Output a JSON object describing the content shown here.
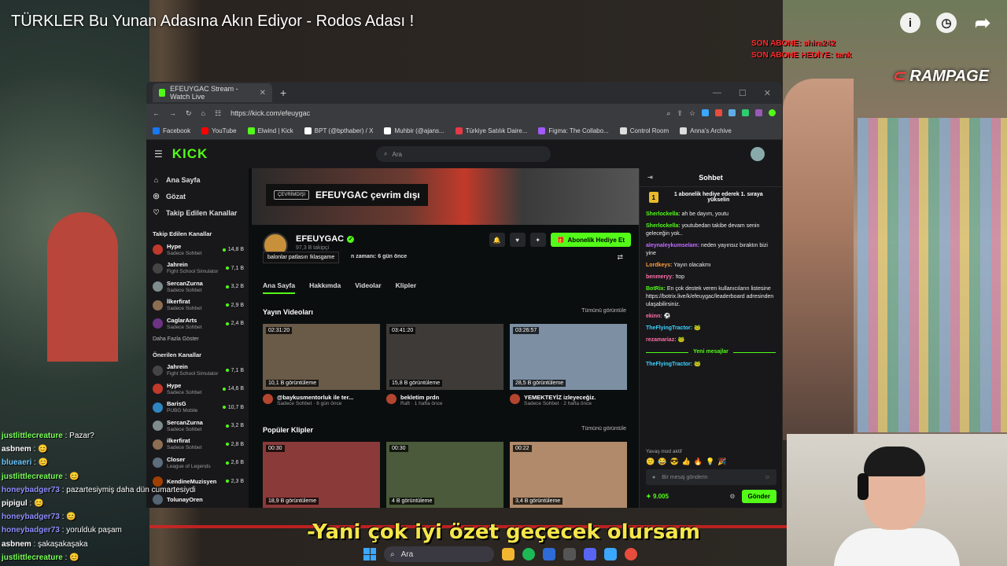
{
  "video": {
    "title": "TÜRKLER Bu Yunan Adasına Akın Ediyor - Rodos Adası !",
    "sub_tag_1": "SON ABONE: shira242",
    "sub_tag_2": "SON ABONE HEDİYE: tarık",
    "brand": "RAMPAGE",
    "subtitle": "-Yani çok iyi özet geçecek olursam"
  },
  "browser": {
    "tab_title": "EFEUYGAC Stream - Watch Live",
    "url": "https://kick.com/efeuygac",
    "bookmarks": [
      {
        "label": "Facebook",
        "color": "#1877f2"
      },
      {
        "label": "YouTube",
        "color": "#ff0000"
      },
      {
        "label": "Elwind | Kick",
        "color": "#53fc18"
      },
      {
        "label": "BPT (@bpthaber) / X",
        "color": "#ffffff"
      },
      {
        "label": "Muhbir (@ajans...",
        "color": "#ffffff"
      },
      {
        "label": "Türkiye Satılık Daire...",
        "color": "#e63946"
      },
      {
        "label": "Figma: The Collabo...",
        "color": "#a259ff"
      },
      {
        "label": "Control Room",
        "color": "#dddddd"
      },
      {
        "label": "Anna's Archive",
        "color": "#dddddd"
      }
    ]
  },
  "kick": {
    "logo": "KICK",
    "search_placeholder": "Ara",
    "nav": [
      "Ana Sayfa",
      "Gözat",
      "Takip Edilen Kanallar"
    ],
    "followed_title": "Takip Edilen Kanallar",
    "followed": [
      {
        "name": "Hype",
        "category": "Sadece Sohbet",
        "viewers": "14,8 B",
        "color": "#c0392b"
      },
      {
        "name": "Jahrein",
        "category": "Fight School Simulator",
        "viewers": "7,1 B",
        "color": "#444444"
      },
      {
        "name": "SercanZurna",
        "category": "Sadece Sohbet",
        "viewers": "3,2 B",
        "color": "#7f8c8d"
      },
      {
        "name": "İlkerfirat",
        "category": "Sadece Sohbet",
        "viewers": "2,9 B",
        "color": "#8e6e53"
      },
      {
        "name": "CaglarArts",
        "category": "Sadece Sohbet",
        "viewers": "2,4 B",
        "color": "#6c3483"
      }
    ],
    "show_more": "Daha Fazla Göster",
    "recommended_title": "Önerilen Kanallar",
    "recommended": [
      {
        "name": "Jahrein",
        "category": "Fight School Simulator",
        "viewers": "7,1 B",
        "color": "#444444"
      },
      {
        "name": "Hype",
        "category": "Sadece Sohbet",
        "viewers": "14,6 B",
        "color": "#c0392b"
      },
      {
        "name": "BarisG",
        "category": "PUBG Mobile",
        "viewers": "10,7 B",
        "color": "#2e86c1"
      },
      {
        "name": "SercanZurna",
        "category": "Sadece Sohbet",
        "viewers": "3,2 B",
        "color": "#7f8c8d"
      },
      {
        "name": "ilkerfirat",
        "category": "Sadece Sohbet",
        "viewers": "2,8 B",
        "color": "#8e6e53"
      },
      {
        "name": "Closer",
        "category": "League of Legends",
        "viewers": "2,6 B",
        "color": "#5d6d7e"
      },
      {
        "name": "KendineMuzisyen",
        "category": "",
        "viewers": "2,3 B",
        "color": "#a04000"
      },
      {
        "name": "TolunayOren",
        "category": "",
        "viewers": "",
        "color": "#566573"
      }
    ],
    "offline_badge": "ÇEVRİMDIŞI",
    "offline_text": "EFEUYGAC çevrim dışı",
    "channel_name": "EFEUYGAC",
    "followers": "97,3 B takipçi",
    "tooltip": "balonlar patlasın !klasgame",
    "last_live": "n zamanı: 6 gün önce",
    "gift_button": "Abonelik Hediye Et",
    "tabs": [
      "Ana Sayfa",
      "Hakkımda",
      "Videolar",
      "Klipler"
    ],
    "videos_title": "Yayın Videoları",
    "see_all": "Tümünü görüntüle",
    "videos": [
      {
        "duration": "02:31:20",
        "views": "10,1 B görüntüleme",
        "title": "@baykusmentorluk ile ter...",
        "sub": "Sadece Sohbet · 6 gün önce",
        "color": "#6a5a48"
      },
      {
        "duration": "03:41:20",
        "views": "15,8 B görüntüleme",
        "title": "bekletim prdn",
        "sub": "Raft · 1 hafta önce",
        "color": "#3d3a38"
      },
      {
        "duration": "03:26:57",
        "views": "28,5 B görüntüleme",
        "title": "YEMEKTEYİZ izleyeceğiz.",
        "sub": "Sadece Sohbet · 2 hafta önce",
        "color": "#7d8fa3"
      }
    ],
    "clips_title": "Popüler Klipler",
    "clips": [
      {
        "duration": "00:30",
        "views": "18,9 B görüntüleme",
        "color": "#8b3a3a"
      },
      {
        "duration": "00:30",
        "views": "4 B görüntüleme",
        "color": "#4a5a3a"
      },
      {
        "duration": "00:22",
        "views": "3,4 B görüntüleme",
        "color": "#b08a6a"
      }
    ]
  },
  "chat": {
    "title": "Sohbet",
    "pinned": "1 abonelik hediye ederek 1. sıraya yükselin",
    "messages": [
      {
        "user": "Sherlockella:",
        "text": " ah be dayım, youtu",
        "color": "#53fc18"
      },
      {
        "user": "Sherlockella:",
        "text": " youtubedan takibe devam senin geleceğin yok..",
        "color": "#53fc18"
      },
      {
        "user": "aleynaleykumselam:",
        "text": " neden yayınsız bıraktın bizi yine",
        "color": "#c06cff"
      },
      {
        "user": "Lordkeys:",
        "text": " Yayın olacakmı",
        "color": "#ff9e3d"
      },
      {
        "user": "benmeryy:",
        "text": " !top",
        "color": "#ff6fa8"
      },
      {
        "user": "BotRix:",
        "text": " En çok destek veren kullanıcıların listesine https://botrix.live/k/efeuygac/leaderboard adresinden ulaşabilirsiniz.",
        "color": "#53fc18"
      },
      {
        "user": "ekinn:",
        "text": " ⚽",
        "color": "#ff6fa8"
      },
      {
        "user": "TheFlyingTractor:",
        "text": " 🐸",
        "color": "#3dd3ff"
      },
      {
        "user": "rezamariaz:",
        "text": " 🐸",
        "color": "#ff6fa8"
      }
    ],
    "new_messages": "Yeni mesajlar",
    "after_new": {
      "user": "TheFlyingTractor:",
      "text": " 🐸",
      "color": "#3dd3ff"
    },
    "slow_mode": "Yavaş mod aktif",
    "input_placeholder": "Bir mesaj gönderin",
    "points": "9.005",
    "send": "Gönder"
  },
  "stream_chat": [
    {
      "user": "justlittlecreature",
      "text": " : Pazar?",
      "color": "#7cff5a"
    },
    {
      "user": "asbnem",
      "text": " : 😊",
      "color": "#ffffff"
    },
    {
      "user": "blueaeri",
      "text": " : 😊",
      "color": "#6cc8ff"
    },
    {
      "user": "justlittlecreature",
      "text": " : 😊",
      "color": "#7cff5a"
    },
    {
      "user": "honeybadger73",
      "text": " : pazartesiymiş daha dün cumartesiydi",
      "color": "#8f8fff"
    },
    {
      "user": "pipigul",
      "text": " : 😊",
      "color": "#ffffff"
    },
    {
      "user": "honeybadger73",
      "text": " : 😊",
      "color": "#8f8fff"
    },
    {
      "user": "honeybadger73",
      "text": " : yorulduk paşam",
      "color": "#8f8fff"
    },
    {
      "user": "asbnem",
      "text": " : şakaşakaşaka",
      "color": "#ffffff"
    },
    {
      "user": "justlittlecreature",
      "text": " : 😊",
      "color": "#7cff5a"
    }
  ],
  "taskbar": {
    "search": "Ara"
  }
}
